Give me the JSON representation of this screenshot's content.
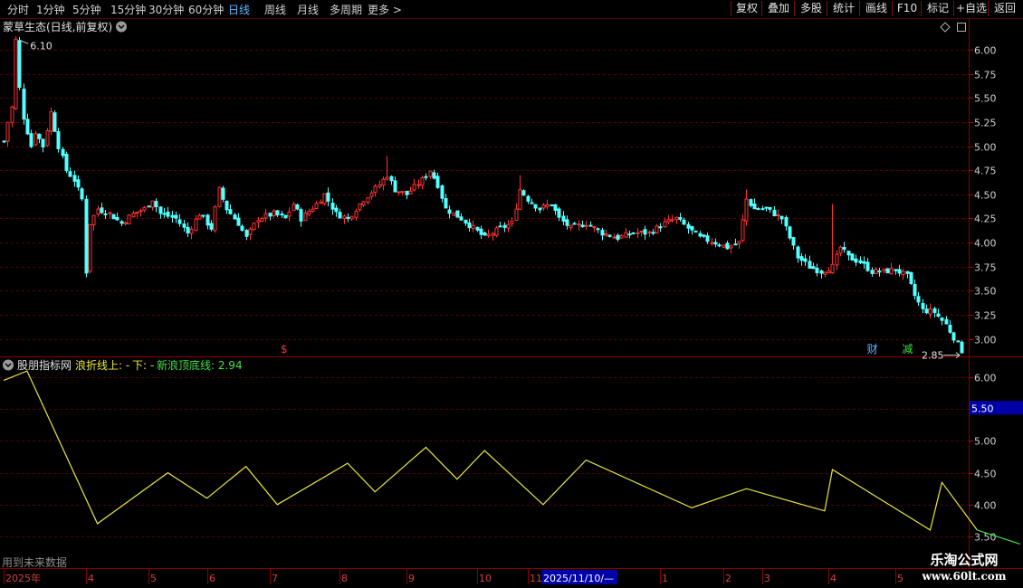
{
  "toolbar": {
    "periods": [
      "分时",
      "1分钟",
      "5分钟",
      "15分钟",
      "30分钟",
      "60分钟",
      "日线",
      "周线",
      "月线",
      "多周期",
      "更多"
    ],
    "active_period": "日线",
    "buttons": [
      "复权",
      "叠加",
      "多股",
      "统计",
      "画线",
      "F10",
      "标记",
      "+自选",
      "返回"
    ]
  },
  "main_panel": {
    "title": "蒙草生态(日线,前复权)",
    "high_label": "6.10",
    "low_label": "2.85",
    "markers": [
      {
        "text": "$",
        "color": "#ff3030",
        "date_index": 72
      },
      {
        "text": "财",
        "color": "#5cb8ff",
        "date_index": 222
      },
      {
        "text": "减",
        "color": "#40e040",
        "date_index": 231
      }
    ]
  },
  "sub_panel": {
    "title": "股朋指标网",
    "legend_up": "浪折线上: -",
    "legend_down": "下: -",
    "legend_new": "新浪顶底线: 2.94",
    "current_tag": "5.50",
    "footer_note": "用到未来数据"
  },
  "date_axis": {
    "labels": [
      {
        "text": "2025年",
        "index": 0
      },
      {
        "text": "4",
        "index": 21
      },
      {
        "text": "5",
        "index": 37
      },
      {
        "text": "6",
        "index": 52
      },
      {
        "text": "7",
        "index": 68
      },
      {
        "text": "8",
        "index": 86
      },
      {
        "text": "9",
        "index": 103
      },
      {
        "text": "10",
        "index": 121
      },
      {
        "text": "11",
        "index": 134
      },
      {
        "text": "2025/11/10/—",
        "index": 138,
        "highlight": true
      },
      {
        "text": "1",
        "index": 168
      },
      {
        "text": "2",
        "index": 184
      },
      {
        "text": "3",
        "index": 194
      },
      {
        "text": "4",
        "index": 211
      },
      {
        "text": "5",
        "index": 228
      }
    ]
  },
  "watermark": {
    "cn": "乐淘公式网",
    "url": "www.60lt.com"
  },
  "chart_data": [
    {
      "type": "candlestick",
      "title": "蒙草生态(日线,前复权)",
      "ylim": [
        2.8,
        6.3
      ],
      "yticks": [
        3.0,
        3.25,
        3.5,
        3.75,
        4.0,
        4.25,
        4.5,
        4.75,
        5.0,
        5.25,
        5.5,
        5.75,
        6.0
      ],
      "colors": {
        "up": "#ff3232",
        "down": "#54ffff"
      },
      "anchors": [
        [
          0,
          5.05
        ],
        [
          1,
          5.25
        ],
        [
          2,
          5.4
        ],
        [
          3,
          6.1
        ],
        [
          4,
          5.6
        ],
        [
          5,
          5.3
        ],
        [
          7,
          5.0
        ],
        [
          8,
          5.15
        ],
        [
          10,
          5.0
        ],
        [
          12,
          5.35
        ],
        [
          14,
          5.0
        ],
        [
          16,
          4.75
        ],
        [
          18,
          4.65
        ],
        [
          20,
          4.45
        ],
        [
          21,
          3.7
        ],
        [
          22,
          4.2
        ],
        [
          24,
          4.35
        ],
        [
          27,
          4.3
        ],
        [
          30,
          4.2
        ],
        [
          33,
          4.3
        ],
        [
          36,
          4.35
        ],
        [
          38,
          4.45
        ],
        [
          40,
          4.3
        ],
        [
          44,
          4.25
        ],
        [
          47,
          4.1
        ],
        [
          50,
          4.3
        ],
        [
          53,
          4.15
        ],
        [
          55,
          4.55
        ],
        [
          57,
          4.35
        ],
        [
          60,
          4.2
        ],
        [
          62,
          4.05
        ],
        [
          65,
          4.25
        ],
        [
          69,
          4.3
        ],
        [
          72,
          4.25
        ],
        [
          74,
          4.4
        ],
        [
          76,
          4.25
        ],
        [
          80,
          4.4
        ],
        [
          82,
          4.5
        ],
        [
          85,
          4.3
        ],
        [
          88,
          4.25
        ],
        [
          92,
          4.45
        ],
        [
          96,
          4.6
        ],
        [
          98,
          4.7
        ],
        [
          100,
          4.55
        ],
        [
          103,
          4.5
        ],
        [
          107,
          4.65
        ],
        [
          109,
          4.75
        ],
        [
          111,
          4.6
        ],
        [
          113,
          4.35
        ],
        [
          117,
          4.25
        ],
        [
          120,
          4.15
        ],
        [
          123,
          4.05
        ],
        [
          127,
          4.15
        ],
        [
          130,
          4.2
        ],
        [
          132,
          4.55
        ],
        [
          134,
          4.45
        ],
        [
          137,
          4.35
        ],
        [
          140,
          4.4
        ],
        [
          142,
          4.25
        ],
        [
          145,
          4.15
        ],
        [
          149,
          4.2
        ],
        [
          153,
          4.1
        ],
        [
          157,
          4.05
        ],
        [
          161,
          4.1
        ],
        [
          165,
          4.1
        ],
        [
          169,
          4.2
        ],
        [
          172,
          4.25
        ],
        [
          175,
          4.15
        ],
        [
          178,
          4.05
        ],
        [
          182,
          4.0
        ],
        [
          185,
          3.95
        ],
        [
          188,
          4.0
        ],
        [
          190,
          4.45
        ],
        [
          192,
          4.35
        ],
        [
          195,
          4.35
        ],
        [
          199,
          4.25
        ],
        [
          201,
          4.05
        ],
        [
          203,
          3.85
        ],
        [
          206,
          3.75
        ],
        [
          209,
          3.7
        ],
        [
          212,
          3.75
        ],
        [
          214,
          3.95
        ],
        [
          216,
          3.85
        ],
        [
          219,
          3.8
        ],
        [
          222,
          3.7
        ],
        [
          225,
          3.7
        ],
        [
          228,
          3.72
        ],
        [
          231,
          3.65
        ],
        [
          233,
          3.45
        ],
        [
          235,
          3.3
        ],
        [
          238,
          3.28
        ],
        [
          241,
          3.15
        ],
        [
          244,
          2.95
        ],
        [
          245,
          2.88
        ]
      ],
      "spikes": [
        [
          4,
          6.1
        ],
        [
          21,
          3.7
        ],
        [
          98,
          4.9
        ],
        [
          132,
          4.7
        ],
        [
          190,
          4.55
        ],
        [
          212,
          4.4
        ],
        [
          245,
          2.85
        ]
      ],
      "count": 246
    },
    {
      "type": "line",
      "title": "股朋指标网",
      "ylim": [
        3.4,
        6.3
      ],
      "yticks": [
        3.5,
        4.0,
        4.5,
        5.0,
        5.5,
        6.0
      ],
      "series": [
        {
          "name": "浪折线上",
          "color": "#e8e840",
          "points": [
            [
              0,
              5.95
            ],
            [
              6,
              6.1
            ],
            [
              24,
              3.7
            ],
            [
              42,
              4.5
            ],
            [
              52,
              4.1
            ],
            [
              62,
              4.6
            ],
            [
              70,
              4.0
            ],
            [
              88,
              4.65
            ],
            [
              95,
              4.2
            ],
            [
              108,
              4.9
            ],
            [
              116,
              4.4
            ],
            [
              123,
              4.85
            ],
            [
              138,
              4.0
            ],
            [
              149,
              4.7
            ],
            [
              176,
              3.95
            ],
            [
              190,
              4.25
            ],
            [
              210,
              3.9
            ],
            [
              212,
              4.55
            ],
            [
              237,
              3.6
            ],
            [
              240,
              4.35
            ],
            [
              249,
              3.6
            ]
          ]
        },
        {
          "name": "新浪顶底线",
          "color": "#40e040",
          "points": [
            [
              249,
              3.6
            ],
            [
              260,
              3.38
            ]
          ]
        }
      ]
    }
  ]
}
